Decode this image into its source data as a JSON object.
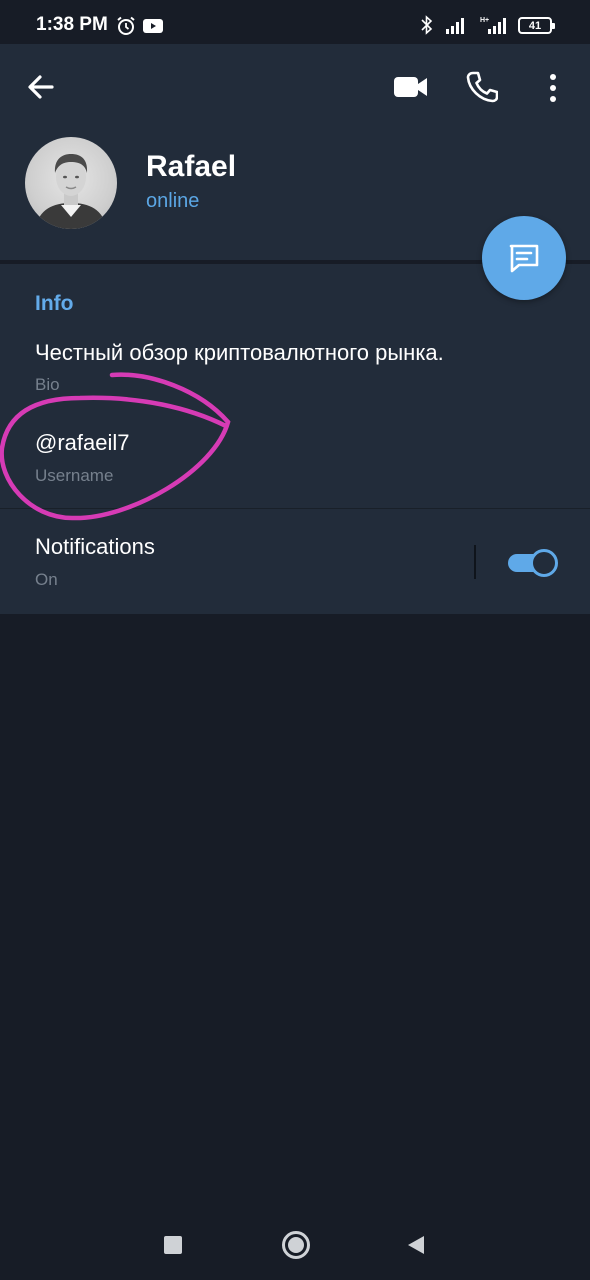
{
  "status_bar": {
    "time": "1:38 PM",
    "battery": "41",
    "icons": [
      "alarm-icon",
      "youtube-icon",
      "bluetooth-icon",
      "signal-icon",
      "signal-hplus-icon",
      "battery-icon"
    ]
  },
  "header": {
    "icons": [
      "back-arrow-icon",
      "video-call-icon",
      "phone-icon",
      "more-vert-icon"
    ]
  },
  "profile": {
    "name": "Rafael",
    "status": "online",
    "status_color": "#5ba6e4"
  },
  "fab": {
    "icon": "message-icon",
    "color": "#5fa9e8"
  },
  "info": {
    "title": "Info",
    "bio_value": "Честный обзор криптовалютного рынка.",
    "bio_label": "Bio",
    "username_value": "@rafaeil7",
    "username_label": "Username"
  },
  "notifications": {
    "label": "Notifications",
    "value": "On",
    "enabled": true
  },
  "annotation": {
    "color": "#d63bb5"
  },
  "colors": {
    "background": "#171c26",
    "panel": "#222c3a",
    "accent": "#5fa9e8",
    "secondary_text": "#76808d"
  },
  "nav_bar": {
    "icons": [
      "recents-icon",
      "home-icon",
      "back-icon"
    ]
  }
}
